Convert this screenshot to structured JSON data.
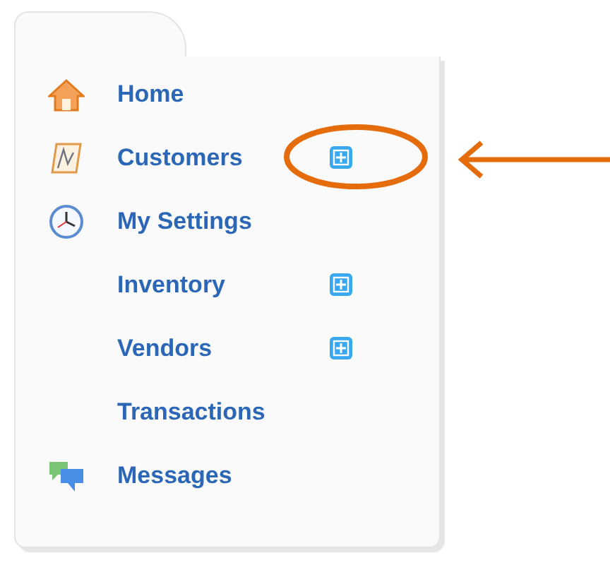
{
  "menu": {
    "items": [
      {
        "label": "Home",
        "kind": "home",
        "expandable": false,
        "highlighted": false
      },
      {
        "label": "Customers",
        "kind": "customers",
        "expandable": true,
        "highlighted": true
      },
      {
        "label": "My Settings",
        "kind": "settings",
        "expandable": false,
        "highlighted": false
      },
      {
        "label": "Inventory",
        "kind": "plain",
        "expandable": true,
        "highlighted": false
      },
      {
        "label": "Vendors",
        "kind": "plain",
        "expandable": true,
        "highlighted": false
      },
      {
        "label": "Transactions",
        "kind": "plain",
        "expandable": false,
        "highlighted": false
      },
      {
        "label": "Messages",
        "kind": "messages",
        "expandable": false,
        "highlighted": false
      }
    ]
  }
}
